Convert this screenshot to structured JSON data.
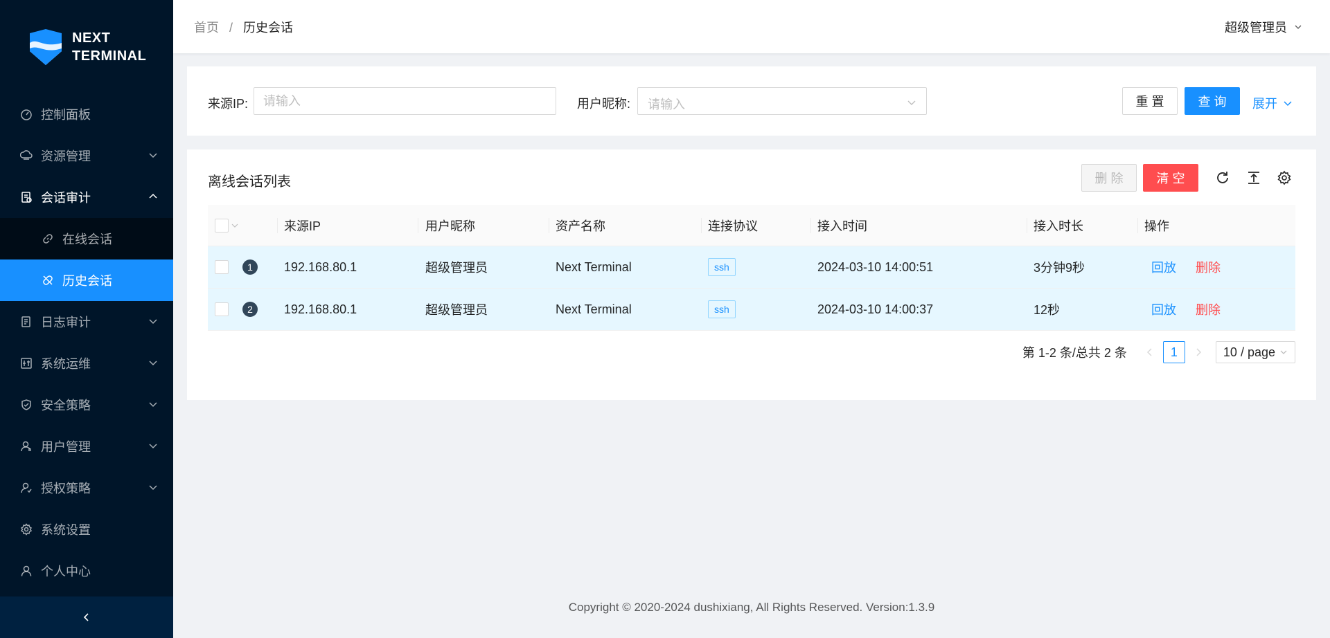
{
  "brand": {
    "line1": "NEXT",
    "line2": "TERMINAL"
  },
  "sidebar": {
    "items": [
      {
        "label": "控制面板",
        "icon": "dashboard-icon"
      },
      {
        "label": "资源管理",
        "icon": "cloud-server-icon"
      },
      {
        "label": "会话审计",
        "icon": "audit-icon"
      },
      {
        "label": "在线会话",
        "icon": "link-icon"
      },
      {
        "label": "历史会话",
        "icon": "disconnect-icon"
      },
      {
        "label": "日志审计",
        "icon": "log-icon"
      },
      {
        "label": "系统运维",
        "icon": "ops-icon"
      },
      {
        "label": "安全策略",
        "icon": "safety-icon"
      },
      {
        "label": "用户管理",
        "icon": "user-icon"
      },
      {
        "label": "授权策略",
        "icon": "authorize-icon"
      },
      {
        "label": "系统设置",
        "icon": "setting-icon"
      },
      {
        "label": "个人中心",
        "icon": "profile-icon"
      }
    ],
    "collapse_icon": "chevron-left-icon"
  },
  "header": {
    "breadcrumb": {
      "home": "首页",
      "separator": "/",
      "current": "历史会话"
    },
    "user": "超级管理员"
  },
  "search": {
    "source_ip_label": "来源IP:",
    "source_ip_placeholder": "请输入",
    "nickname_label": "用户昵称:",
    "nickname_placeholder": "请输入",
    "reset": "重 置",
    "query": "查 询",
    "expand": "展开"
  },
  "table": {
    "title": "离线会话列表",
    "delete": "删 除",
    "clear": "清 空",
    "columns": [
      "来源IP",
      "用户昵称",
      "资产名称",
      "连接协议",
      "接入时间",
      "接入时长",
      "操作"
    ],
    "rows": [
      {
        "index": "1",
        "ip": "192.168.80.1",
        "nickname": "超级管理员",
        "asset": "Next Terminal",
        "protocol": "ssh",
        "time": "2024-03-10 14:00:51",
        "duration": "3分钟9秒",
        "replay": "回放",
        "del": "删除"
      },
      {
        "index": "2",
        "ip": "192.168.80.1",
        "nickname": "超级管理员",
        "asset": "Next Terminal",
        "protocol": "ssh",
        "time": "2024-03-10 14:00:37",
        "duration": "12秒",
        "replay": "回放",
        "del": "删除"
      }
    ]
  },
  "pagination": {
    "total_text": "第 1-2 条/总共 2 条",
    "current": "1",
    "page_size": "10 / page"
  },
  "footer": "Copyright © 2020-2024 dushixiang, All Rights Reserved. Version:1.3.9",
  "colors": {
    "sidebar": "#001529",
    "primary": "#1890ff",
    "danger": "#ff4d4f",
    "row_selected": "#e6f7ff"
  }
}
